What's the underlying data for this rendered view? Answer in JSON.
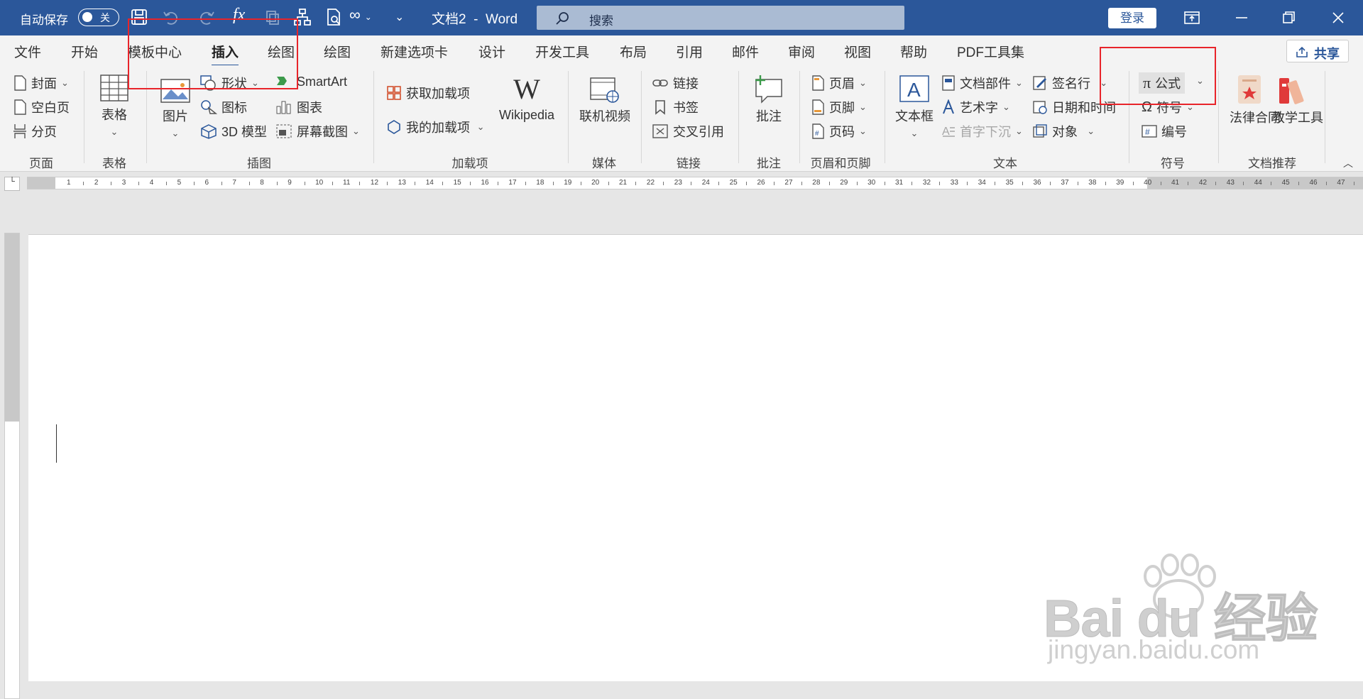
{
  "titlebar": {
    "autosave_label": "自动保存",
    "autosave_state": "关",
    "doc_title": "文档2  -  Word",
    "search_placeholder": "搜索",
    "login_label": "登录"
  },
  "tabs": [
    "文件",
    "开始",
    "模板中心",
    "插入",
    "绘图",
    "绘图",
    "新建选项卡",
    "设计",
    "开发工具",
    "布局",
    "引用",
    "邮件",
    "审阅",
    "视图",
    "帮助",
    "PDF工具集"
  ],
  "active_tab": "插入",
  "share_label": "共享",
  "ribbon": {
    "page": {
      "label": "页面",
      "items": [
        "封面",
        "空白页",
        "分页"
      ]
    },
    "table": {
      "label": "表格",
      "button": "表格"
    },
    "illustrations": {
      "label": "插图",
      "picture": "图片",
      "shapes": "形状",
      "icons": "图标",
      "model3d": "3D 模型",
      "smartart": "SmartArt",
      "chart": "图表",
      "screenshot": "屏幕截图"
    },
    "addins": {
      "label": "加载项",
      "get": "获取加载项",
      "my": "我的加载项",
      "wikipedia": "Wikipedia"
    },
    "media": {
      "label": "媒体",
      "online_video": "联机视频"
    },
    "links": {
      "label": "链接",
      "link": "链接",
      "bookmark": "书签",
      "cross_ref": "交叉引用"
    },
    "comments": {
      "label": "批注",
      "comment": "批注"
    },
    "header_footer": {
      "label": "页眉和页脚",
      "header": "页眉",
      "footer": "页脚",
      "page_number": "页码"
    },
    "text": {
      "label": "文本",
      "textbox": "文本框",
      "quick_parts": "文档部件",
      "wordart": "艺术字",
      "dropcap": "首字下沉",
      "signature": "签名行",
      "datetime": "日期和时间",
      "object": "对象"
    },
    "symbols": {
      "label": "符号",
      "equation": "公式",
      "symbol": "符号",
      "numbering": "编号"
    },
    "doc_recommend": {
      "label": "文档推荐",
      "legal": "法律合同",
      "teaching": "教学工具"
    }
  },
  "ruler_numbers": [
    "1",
    "2",
    "3",
    "4",
    "5",
    "6",
    "7",
    "8",
    "9",
    "10",
    "11",
    "12",
    "13",
    "14",
    "15",
    "16",
    "17",
    "18",
    "19",
    "20",
    "21",
    "22",
    "23",
    "24",
    "25",
    "26",
    "27",
    "28",
    "29",
    "30",
    "31",
    "32",
    "33",
    "34",
    "35",
    "36",
    "37",
    "38",
    "39",
    "40",
    "41",
    "42",
    "43",
    "44",
    "45",
    "46",
    "47"
  ],
  "watermark": {
    "brand": "Bai du 经验",
    "url": "jingyan.baidu.com"
  },
  "colors": {
    "titlebar": "#2b579a",
    "highlight": "#e8242a",
    "ribbon_bg": "#f3f3f3"
  }
}
